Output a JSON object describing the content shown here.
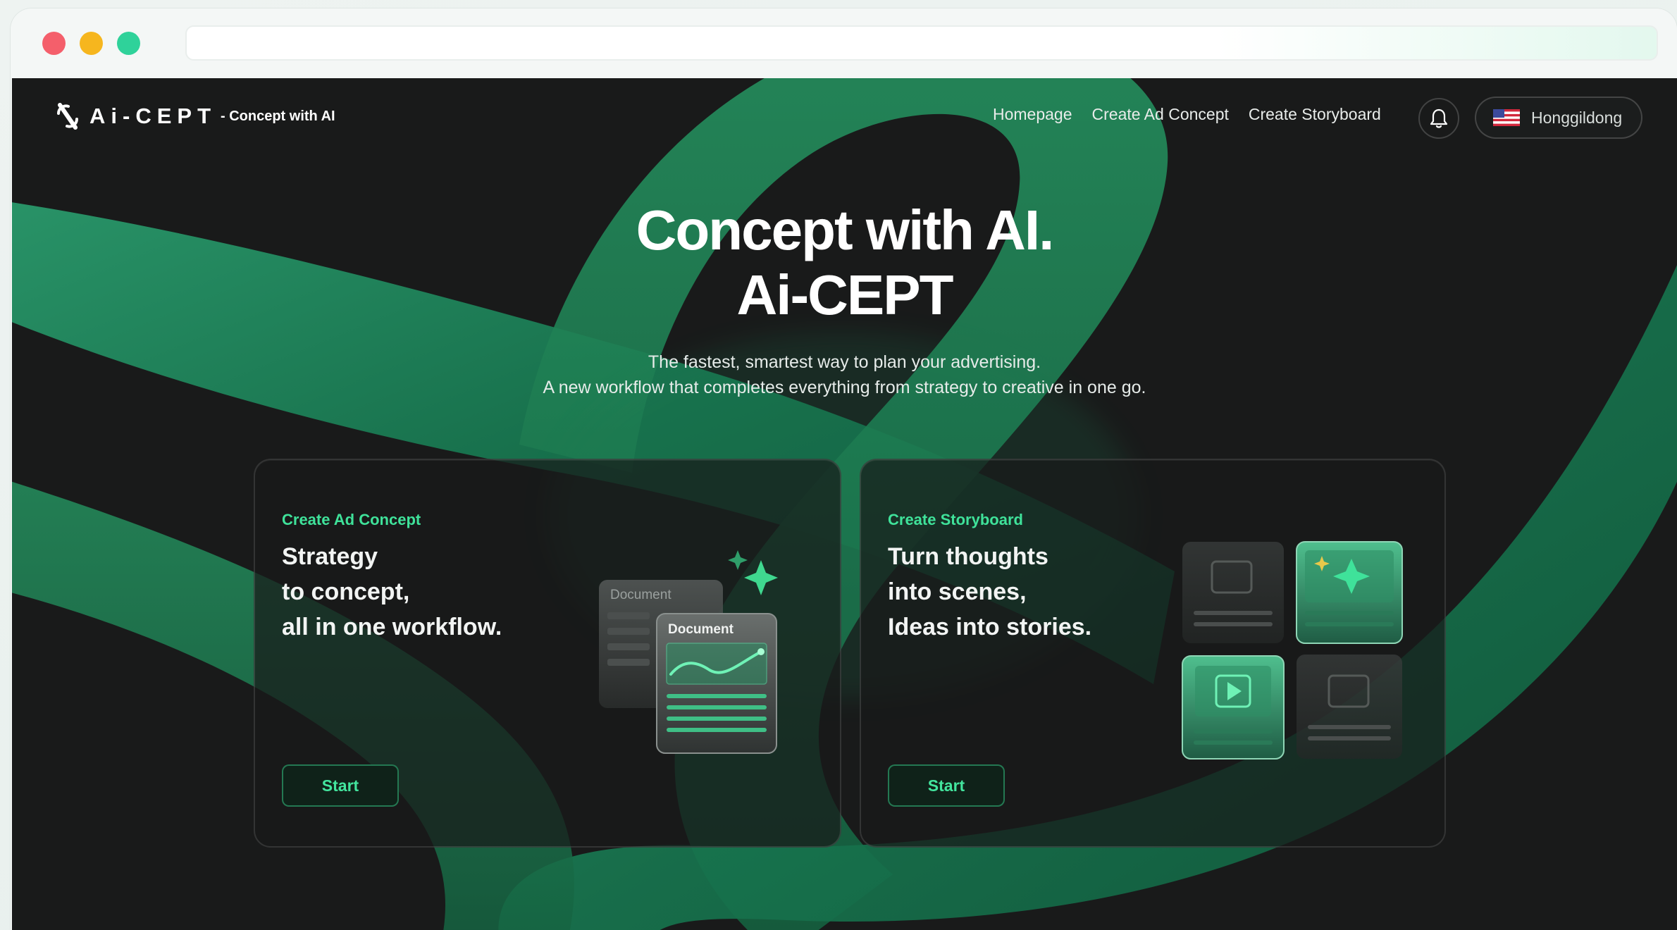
{
  "nav": {
    "brand": "Ai-CEPT",
    "tagline": "- Concept with AI",
    "links": [
      "Homepage",
      "Create Ad Concept",
      "Create Storyboard"
    ],
    "user_name": "Honggildong",
    "bell_icon": "bell-icon",
    "flag_icon": "us-flag-icon"
  },
  "hero": {
    "title_line1": "Concept with AI.",
    "title_line2": "Ai-CEPT",
    "subtitle_line1": "The fastest, smartest way to plan your advertising.",
    "subtitle_line2": "A new workflow that completes everything from strategy to creative in one go."
  },
  "cards": [
    {
      "kicker": "Create Ad Concept",
      "lines": [
        "Strategy",
        "to concept,",
        "all in one workflow."
      ],
      "button": "Start",
      "doc_back_label": "Document",
      "doc_front_label": "Document"
    },
    {
      "kicker": "Create Storyboard",
      "lines": [
        "Turn thoughts",
        "into scenes,",
        "Ideas into stories."
      ],
      "button": "Start"
    }
  ],
  "colors": {
    "accent": "#3fe29a",
    "background": "#191a1a",
    "swirl": "#1f8a5f"
  }
}
